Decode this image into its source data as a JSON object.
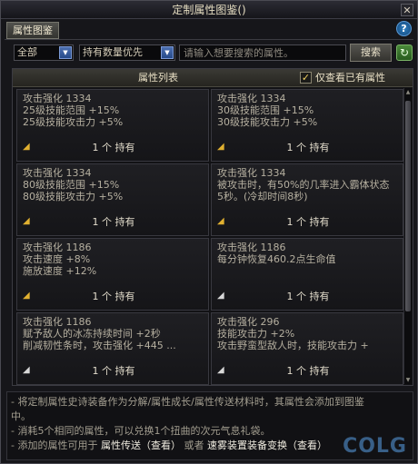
{
  "window": {
    "title": "定制属性图鉴()"
  },
  "tabs": {
    "active": "属性图鉴"
  },
  "filters": {
    "category": "全部",
    "sort": "持有数量优先",
    "search_placeholder": "请输入想要搜索的属性。",
    "search_button": "搜索"
  },
  "list": {
    "header": "属性列表",
    "owned_only_label": "仅查看已有属性",
    "owned_only_checked": true,
    "cards": [
      {
        "lines": [
          "攻击强化 1334",
          "25级技能范围 +15%",
          "25级技能攻击力 +5%"
        ],
        "count": "1 个 持有",
        "icon": "gold-horn-icon"
      },
      {
        "lines": [
          "攻击强化 1334",
          "30级技能范围 +15%",
          "30级技能攻击力 +5%"
        ],
        "count": "1 个 持有",
        "icon": "gold-horn-icon"
      },
      {
        "lines": [
          "攻击强化 1334",
          "80级技能范围 +15%",
          "80级技能攻击力 +5%"
        ],
        "count": "1 个 持有",
        "icon": "gold-horn-icon"
      },
      {
        "lines": [
          "攻击强化 1334",
          "被攻击时，有50%的几率进入霸体状态",
          "5秒。(冷却时间8秒)"
        ],
        "count": "1 个 持有",
        "icon": "gold-horn-icon"
      },
      {
        "lines": [
          "攻击强化 1186",
          "攻击速度 +8%",
          "施放速度 +12%"
        ],
        "count": "1 个 持有",
        "icon": "gold-horn-icon"
      },
      {
        "lines": [
          "攻击强化 1186",
          "每分钟恢复460.2点生命值",
          ""
        ],
        "count": "1 个 持有",
        "icon": "silver-horn-icon"
      },
      {
        "lines": [
          "攻击强化 1186",
          "赋予敌人的冰冻持续时间 +2秒",
          "削减韧性条时，攻击强化 +445 ..."
        ],
        "count": "1 个 持有",
        "icon": "silver-horn-icon"
      },
      {
        "lines": [
          "攻击强化 296",
          "技能攻击力 +2%",
          "攻击野蛮型敌人时，技能攻击力 +"
        ],
        "count": "1 个 持有",
        "icon": "silver-horn-icon"
      }
    ]
  },
  "info": {
    "line1a": "- 将定制属性史诗装备作为分解/属性成长/属性传送材料时，其属性会添加到图鉴",
    "line1b": "中。",
    "line2": "- 消耗5个相同的属性，可以兑换1个扭曲的次元气息礼袋。",
    "line3_prefix": "- 添加的属性可用于",
    "line3_link1": "属性传送（查看）",
    "line3_mid": "或者",
    "line3_link2": "速雾装置装备变换（查看）",
    "watermark": "COLG"
  }
}
